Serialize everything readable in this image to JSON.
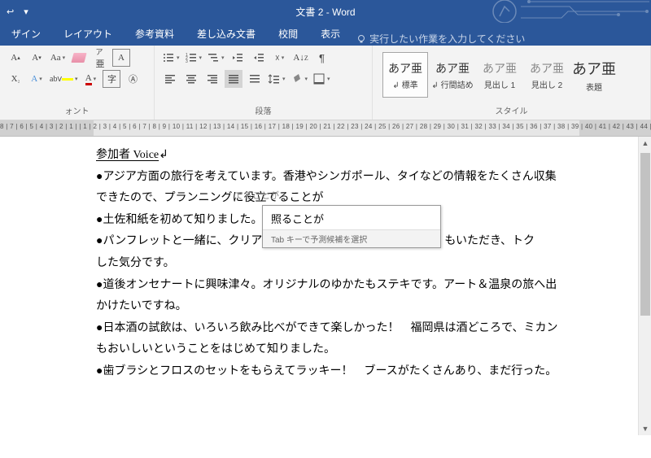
{
  "titlebar": {
    "title": "文書 2  -  Word"
  },
  "tabs": {
    "items": [
      "ザイン",
      "レイアウト",
      "参考資料",
      "差し込み文書",
      "校閲",
      "表示"
    ],
    "tellme_placeholder": "実行したい作業を入力してください"
  },
  "ribbon": {
    "font_group_label": "ォント",
    "para_group_label": "段落",
    "style_group_label": "スタイル"
  },
  "styles": {
    "items": [
      {
        "sample": "あア亜",
        "name": "↲ 標準",
        "selected": true
      },
      {
        "sample": "あア亜",
        "name": "↲ 行間詰め",
        "selected": false
      },
      {
        "sample": "あア亜",
        "name": "見出し 1",
        "selected": false
      },
      {
        "sample": "あア亜",
        "name": "見出し 2",
        "selected": false
      },
      {
        "sample": "あア亜",
        "name": "表題",
        "selected": false
      }
    ]
  },
  "ruler": {
    "text": "8 | 7 | 6 | 5 | 4 | 3 | 2 | 1 |    | 1 | 2 | 3 | 4 | 5 | 6 | 7 | 8 | 9 | 10 | 11 | 12 | 13 | 14 | 15 | 16 | 17 | 18 | 19 | 20 | 21 | 22 | 23 | 24 | 25 | 26 | 27 | 28 | 29 | 30 | 31 | 32 | 33 | 34 | 35 | 36 | 37 | 38 | 39 | 40 | 41 | 42 | 43 | 44 | 45 | 46 | 47 |"
  },
  "document": {
    "heading": "参加者 Voice",
    "lines": [
      "●アジア方面の旅行を考えています。香港やシンガポール、タイなどの情報をたくさん収集",
      "できたので、プランニングに役立てることが",
      "●土佐和紙を初めて知りました。",
      "●パンフレットと一緒に、クリア　　　　　　　　　　　　　　　　もいただき、トク",
      "した気分です。",
      "●道後オンセナートに興味津々。オリジナルのゆかたもステキです。アート＆温泉の旅へ出",
      "かけたいですね。",
      "●日本酒の試飲は、いろいろ飲み比べができて楽しかった！　福岡県は酒どころで、ミカン",
      "もおいしいということをはじめて知りました。",
      "●歯ブラシとフロスのセットをもらえてラッキー！　ブースがたくさんあり、まだ行った。"
    ]
  },
  "ime": {
    "inline_hint": "てることが",
    "candidate": "照ることが",
    "instruction": "Tab キーで予測候補を選択"
  }
}
